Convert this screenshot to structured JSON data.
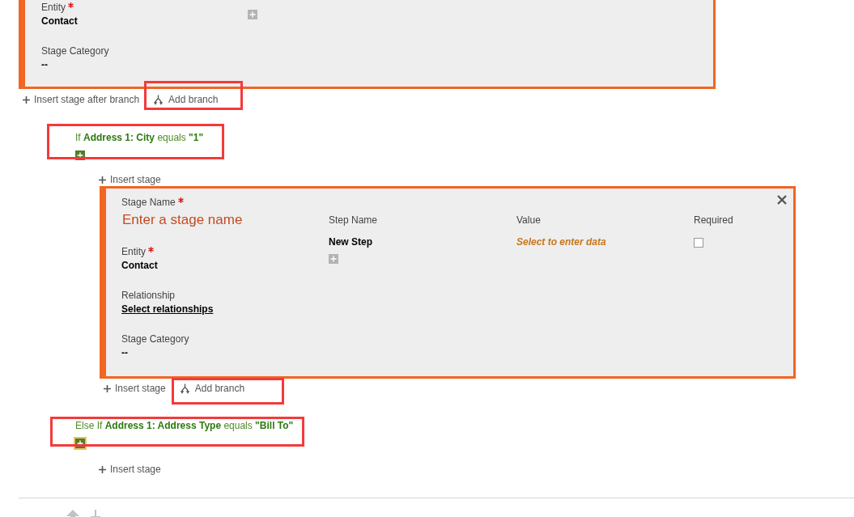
{
  "top_stage": {
    "fields": [
      {
        "label": "Entity",
        "required": true,
        "value": "Contact",
        "kind": "text"
      },
      {
        "label": "Stage Category",
        "required": false,
        "value": "--",
        "kind": "text"
      }
    ]
  },
  "top_actions": {
    "insert_label": "Insert stage after branch",
    "branch_label": "Add branch",
    "highlighted": true
  },
  "branches": [
    {
      "condition": "If **Address 1: City** equals **\"1\"**",
      "highlighted": true,
      "add_focused": false,
      "insert_label": "Insert stage",
      "stage": {
        "name_label": "Stage Name",
        "name_required": true,
        "name_placeholder": "Enter a stage name",
        "fields": [
          {
            "label": "Entity",
            "required": true,
            "value": "Contact",
            "kind": "text"
          },
          {
            "label": "Relationship",
            "required": false,
            "value": "Select relationships",
            "kind": "link"
          },
          {
            "label": "Stage Category",
            "required": false,
            "value": "--",
            "kind": "text"
          }
        ],
        "step_columns": [
          "Step Name",
          "Value",
          "Required"
        ],
        "steps": [
          {
            "name": "New Step",
            "value": "Select to enter data",
            "required": false
          }
        ]
      },
      "actions": {
        "insert_label": "Insert stage",
        "branch_label": "Add branch",
        "highlighted": true
      }
    },
    {
      "condition": "Else If **Address 1: Address Type** equals **\"Bill To\"**",
      "highlighted": true,
      "add_focused": true,
      "insert_label": "Insert stage"
    }
  ]
}
